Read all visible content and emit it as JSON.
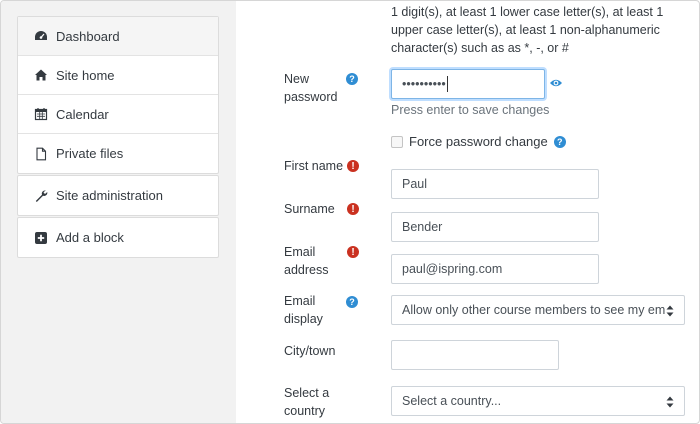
{
  "sidebar": {
    "nav": [
      {
        "label": "Dashboard",
        "icon": "dashboard-icon"
      },
      {
        "label": "Site home",
        "icon": "home-icon"
      },
      {
        "label": "Calendar",
        "icon": "calendar-icon"
      },
      {
        "label": "Private files",
        "icon": "file-icon"
      }
    ],
    "admin": {
      "label": "Site administration",
      "icon": "wrench-icon"
    },
    "add_block": {
      "label": "Add a block",
      "icon": "plus-square-icon"
    }
  },
  "form": {
    "password_hint_line1": "1 digit(s), at least 1 lower case letter(s), at least 1",
    "password_hint_line2": "upper case letter(s), at least 1 non-alphanumeric",
    "password_hint_line3": "character(s) such as as *, -, or #",
    "new_password": {
      "label_line1": "New",
      "label_line2": "password",
      "value": "••••••••••"
    },
    "save_note": "Press enter to save changes",
    "force_change": {
      "label": "Force password change",
      "checked": false
    },
    "first_name": {
      "label": "First name",
      "value": "Paul"
    },
    "surname": {
      "label": "Surname",
      "value": "Bender"
    },
    "email": {
      "label_line1": "Email",
      "label_line2": "address",
      "value": "paul@ispring.com"
    },
    "email_display": {
      "label_line1": "Email",
      "label_line2": "display",
      "value": "Allow only other course members to see my em"
    },
    "city": {
      "label": "City/town",
      "value": ""
    },
    "country": {
      "label_line1": "Select a",
      "label_line2": "country",
      "value": "Select a country..."
    }
  },
  "colors": {
    "required": "#ca3120",
    "help": "#2f8dd3",
    "sidebar_bg": "#f2f2f2"
  }
}
